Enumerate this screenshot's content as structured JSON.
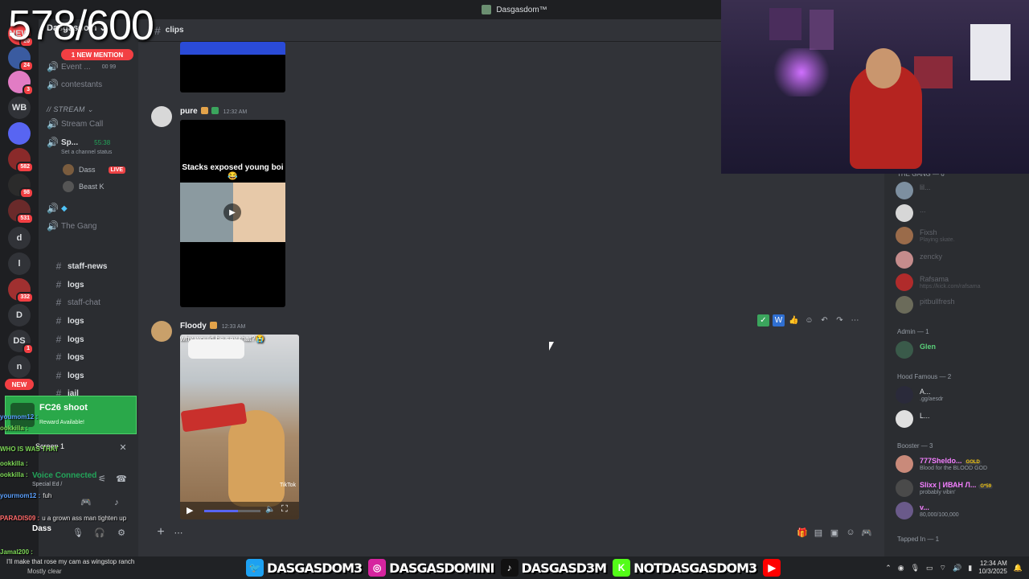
{
  "window_title": "Dasgasdom™",
  "counter": "578/600",
  "server": {
    "name": "Dasgasdom",
    "mention_pill": "1 NEW MENTION",
    "rail": [
      {
        "label": "NEW",
        "badge": "20",
        "color": "#f23f43"
      },
      {
        "label": "",
        "badge": "24",
        "color": "#3a5ba0"
      },
      {
        "label": "",
        "badge": "3",
        "color": "#e17cc4"
      },
      {
        "label": "WB",
        "badge": "",
        "color": "#313338"
      },
      {
        "label": "",
        "badge": "",
        "color": "#5865f2"
      },
      {
        "label": "",
        "badge": "582",
        "color": "#8a2a2a"
      },
      {
        "label": "",
        "badge": "98",
        "color": "#2b2b2b"
      },
      {
        "label": "",
        "badge": "531",
        "color": "#6a2a2a"
      },
      {
        "label": "d",
        "badge": "",
        "color": "#313338"
      },
      {
        "label": "l",
        "badge": "",
        "color": "#313338"
      },
      {
        "label": "",
        "badge": "332",
        "color": "#a03030"
      },
      {
        "label": "D",
        "badge": "",
        "color": "#313338"
      },
      {
        "label": "DS",
        "badge": "1",
        "color": "#313338"
      },
      {
        "label": "n",
        "badge": "",
        "color": "#313338"
      }
    ],
    "rail_new": "NEW"
  },
  "channels": {
    "event": "Event ...",
    "event_count": "00 99",
    "contestants": "contestants",
    "stream_category": "// STREAM",
    "stream_call": "Stream Call",
    "sp_channel": "Sp...",
    "sp_time": "55:38",
    "channel_status": "Set a channel status",
    "voice_users": [
      {
        "name": "Dass",
        "live": "LIVE"
      },
      {
        "name": "Beast K",
        "live": ""
      }
    ],
    "the_gang": "The Gang",
    "text": [
      {
        "name": "staff-news",
        "bright": true
      },
      {
        "name": "logs",
        "bright": true
      },
      {
        "name": "staff-chat",
        "bright": false
      },
      {
        "name": "logs",
        "bright": true
      },
      {
        "name": "logs",
        "bright": true
      },
      {
        "name": "logs",
        "bright": true
      },
      {
        "name": "logs",
        "bright": true
      },
      {
        "name": "jail",
        "bright": true
      }
    ]
  },
  "overlay": {
    "reward_title": "FC26 shoot",
    "reward_sub": "Reward Available!",
    "screen_label": "Screen 1",
    "voice_connected": "Voice Connected",
    "voice_sub": "Special Ed /",
    "username": "Dass",
    "chat": [
      {
        "user": "youmom12 :",
        "text": "",
        "cls": "u2"
      },
      {
        "user": "ookkilla :",
        "text": "",
        "cls": "u"
      },
      {
        "user": "WHO IS WAS THAT",
        "text": "",
        "cls": "u"
      },
      {
        "user": "ookkilla :",
        "text": "",
        "cls": "u"
      },
      {
        "user": "ookkilla :",
        "text": "",
        "cls": "u"
      },
      {
        "user": "yourmom12 :",
        "text": "fuh",
        "cls": "u2"
      },
      {
        "user": "PARADIS09 :",
        "text": "u a grown ass man tighten up",
        "cls": "u3"
      },
      {
        "user": "Jamal200 :",
        "text": "",
        "cls": "u"
      }
    ],
    "weather_line": "I'll make that rose my cam as wingstop ranch",
    "weather_sub": "Mostly clear"
  },
  "chat": {
    "channel": "clips",
    "messages": [
      {
        "user": "pure",
        "time": "12:32 AM",
        "caption": "Stacks exposed young boi😂"
      },
      {
        "user": "Floody",
        "time": "12:33 AM",
        "caption": "why would he say that?😭"
      }
    ],
    "video_brand": "TikTok",
    "video_progress": 0.6
  },
  "members": {
    "gang_header": "THE GANG — 6",
    "gang": [
      {
        "name": "lil...",
        "status": ""
      },
      {
        "name": "...",
        "status": ""
      },
      {
        "name": "Fixsh",
        "status": "Playing skate."
      },
      {
        "name": "zencky",
        "status": ""
      },
      {
        "name": "Rafsama",
        "status": "https://kick.com/rafsama"
      },
      {
        "name": "pitbullfresh",
        "status": ""
      }
    ],
    "admin_header": "Admin — 1",
    "admin": [
      {
        "name": "Glen",
        "status": ""
      }
    ],
    "hood_header": "Hood Famous — 2",
    "hood": [
      {
        "name": "A...",
        "status": ".gg/aesdr"
      },
      {
        "name": "L...",
        "status": ""
      }
    ],
    "booster_header": "Booster — 3",
    "boosters": [
      {
        "name": "777Sheldo...",
        "tag": "GOLD",
        "status": "Blood for the BLOOD GOD"
      },
      {
        "name": "Slixx | ИВАН Л...",
        "tag": "G*59",
        "status": "probably vibin'"
      },
      {
        "name": "v...",
        "tag": "",
        "status": "80,000/100,000"
      }
    ],
    "tapped_header": "Tapped In — 1"
  },
  "banner": {
    "handles": [
      {
        "icon": "twitter-icon",
        "glyph": "🐦",
        "color": "#1da1f2",
        "text": "DASGASDOM3"
      },
      {
        "icon": "instagram-icon",
        "glyph": "◎",
        "color": "#d6249f",
        "text": "DASGASDOMINI"
      },
      {
        "icon": "tiktok-icon",
        "glyph": "♪",
        "color": "#111111",
        "text": "DASGASD3M"
      },
      {
        "icon": "kick-icon",
        "glyph": "K",
        "color": "#53fc18",
        "text": "NOTDASGASDOM3"
      },
      {
        "icon": "youtube-icon",
        "glyph": "▶",
        "color": "#ff0000",
        "text": ""
      }
    ],
    "time": "12:34 AM",
    "date": "10/3/2025"
  }
}
